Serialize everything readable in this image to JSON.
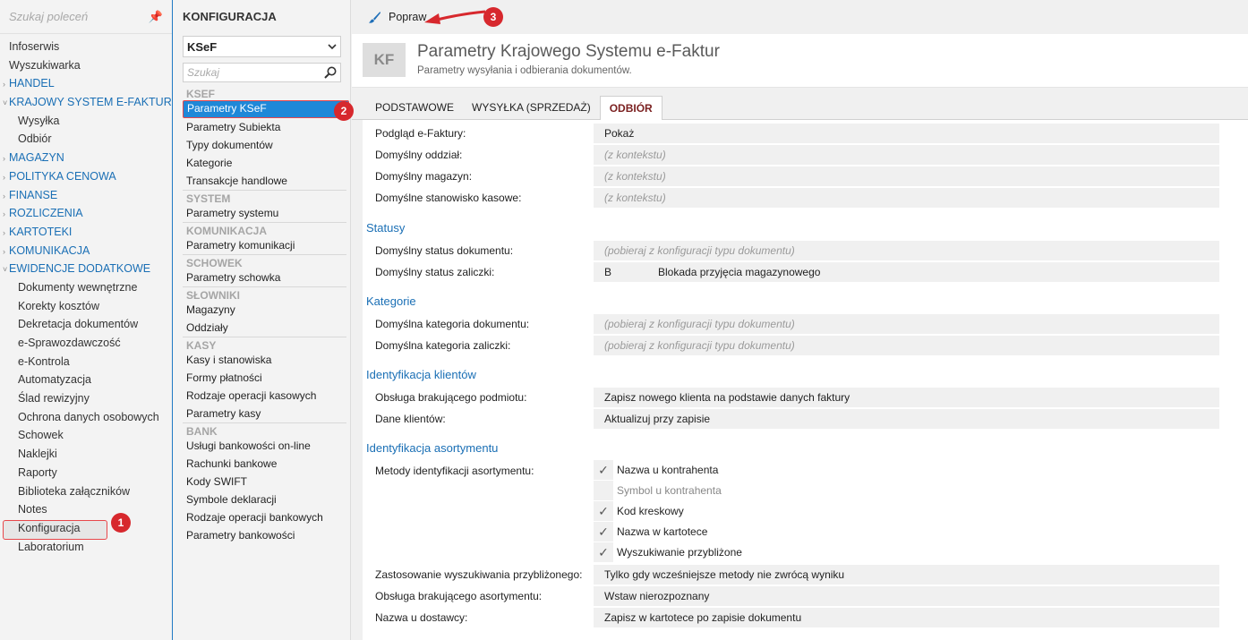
{
  "nav": {
    "search_placeholder": "Szukaj poleceń",
    "items": [
      {
        "type": "top",
        "label": "Infoserwis"
      },
      {
        "type": "top",
        "label": "Wyszukiwarka"
      },
      {
        "type": "sect",
        "label": "HANDEL",
        "chev": "›"
      },
      {
        "type": "sect",
        "label": "KRAJOWY SYSTEM E-FAKTUR",
        "chev": "˅"
      },
      {
        "type": "sub",
        "label": "Wysyłka"
      },
      {
        "type": "sub",
        "label": "Odbiór"
      },
      {
        "type": "sect",
        "label": "MAGAZYN",
        "chev": "›"
      },
      {
        "type": "sect",
        "label": "POLITYKA CENOWA",
        "chev": "›"
      },
      {
        "type": "sect",
        "label": "FINANSE",
        "chev": "›"
      },
      {
        "type": "sect",
        "label": "ROZLICZENIA",
        "chev": "›"
      },
      {
        "type": "sect",
        "label": "KARTOTEKI",
        "chev": "›"
      },
      {
        "type": "sect",
        "label": "KOMUNIKACJA",
        "chev": "›"
      },
      {
        "type": "sect",
        "label": "EWIDENCJE DODATKOWE",
        "chev": "˅"
      },
      {
        "type": "sub",
        "label": "Dokumenty wewnętrzne"
      },
      {
        "type": "sub",
        "label": "Korekty kosztów"
      },
      {
        "type": "sub",
        "label": "Dekretacja dokumentów"
      },
      {
        "type": "sub",
        "label": "e-Sprawozdawczość"
      },
      {
        "type": "sub",
        "label": "e-Kontrola"
      },
      {
        "type": "sub",
        "label": "Automatyzacja"
      },
      {
        "type": "sub",
        "label": "Ślad rewizyjny"
      },
      {
        "type": "sub",
        "label": "Ochrona danych osobowych"
      },
      {
        "type": "sub",
        "label": "Schowek"
      },
      {
        "type": "sub",
        "label": "Naklejki"
      },
      {
        "type": "sub",
        "label": "Raporty"
      },
      {
        "type": "sub",
        "label": "Biblioteka załączników"
      },
      {
        "type": "sub",
        "label": "Notes"
      },
      {
        "type": "sub",
        "label": "Konfiguracja",
        "selected": true
      },
      {
        "type": "sub",
        "label": "Laboratorium"
      }
    ]
  },
  "cfg": {
    "title": "KONFIGURACJA",
    "combo_value": "KSeF",
    "search_placeholder": "Szukaj",
    "groups": [
      {
        "name": "KSEF",
        "items": [
          "Parametry KSeF",
          "Parametry Subiekta",
          "Typy dokumentów",
          "Kategorie",
          "Transakcje handlowe"
        ]
      },
      {
        "name": "SYSTEM",
        "items": [
          "Parametry systemu"
        ]
      },
      {
        "name": "KOMUNIKACJA",
        "items": [
          "Parametry komunikacji"
        ]
      },
      {
        "name": "SCHOWEK",
        "items": [
          "Parametry schowka"
        ]
      },
      {
        "name": "SŁOWNIKI",
        "items": [
          "Magazyny",
          "Oddziały"
        ]
      },
      {
        "name": "KASY",
        "items": [
          "Kasy i stanowiska",
          "Formy płatności",
          "Rodzaje operacji kasowych",
          "Parametry kasy"
        ]
      },
      {
        "name": "BANK",
        "items": [
          "Usługi bankowości on-line",
          "Rachunki bankowe",
          "Kody SWIFT",
          "Symbole deklaracji",
          "Rodzaje operacji bankowych",
          "Parametry bankowości"
        ]
      }
    ],
    "active_item": "Parametry KSeF"
  },
  "toolbar": {
    "edit_label": "Popraw"
  },
  "header": {
    "badge": "KF",
    "title": "Parametry Krajowego Systemu e-Faktur",
    "subtitle": "Parametry wysyłania i odbierania dokumentów."
  },
  "tabs": [
    {
      "label": "PODSTAWOWE",
      "active": false
    },
    {
      "label": "WYSYŁKA (SPRZEDAŻ)",
      "active": false
    },
    {
      "label": "ODBIÓR",
      "active": true
    }
  ],
  "form": {
    "rows1": [
      {
        "label": "Podgląd e-Faktury:",
        "value": "Pokaż",
        "ph": false
      },
      {
        "label": "Domyślny oddział:",
        "value": "(z kontekstu)",
        "ph": true
      },
      {
        "label": "Domyślny magazyn:",
        "value": "(z kontekstu)",
        "ph": true
      },
      {
        "label": "Domyślne stanowisko kasowe:",
        "value": "(z kontekstu)",
        "ph": true
      }
    ],
    "sec_statusy": "Statusy",
    "status_doc": {
      "label": "Domyślny status dokumentu:",
      "value": "(pobieraj z konfiguracji typu dokumentu)"
    },
    "status_zal": {
      "label": "Domyślny status zaliczki:",
      "code": "B",
      "value": "Blokada przyjęcia magazynowego"
    },
    "sec_kategorie": "Kategorie",
    "kat_doc": {
      "label": "Domyślna kategoria dokumentu:",
      "value": "(pobieraj z konfiguracji typu dokumentu)"
    },
    "kat_zal": {
      "label": "Domyślna kategoria zaliczki:",
      "value": "(pobieraj z konfiguracji typu dokumentu)"
    },
    "sec_klienci": "Identyfikacja klientów",
    "kl_brak": {
      "label": "Obsługa brakującego podmiotu:",
      "value": "Zapisz nowego klienta na podstawie danych faktury"
    },
    "kl_dane": {
      "label": "Dane klientów:",
      "value": "Aktualizuj przy zapisie"
    },
    "sec_asort": "Identyfikacja asortymentu",
    "metody_label": "Metody identyfikacji asortymentu:",
    "checks": [
      {
        "label": "Nazwa u kontrahenta",
        "checked": true
      },
      {
        "label": "Symbol u kontrahenta",
        "checked": false
      },
      {
        "label": "Kod kreskowy",
        "checked": true
      },
      {
        "label": "Nazwa w kartotece",
        "checked": true
      },
      {
        "label": "Wyszukiwanie przybliżone",
        "checked": true
      }
    ],
    "zast": {
      "label": "Zastosowanie wyszukiwania przybliżonego:",
      "value": "Tylko gdy wcześniejsze metody nie zwrócą wyniku"
    },
    "brak_as": {
      "label": "Obsługa brakującego asortymentu:",
      "value": "Wstaw nierozpoznany"
    },
    "naz_dost": {
      "label": "Nazwa u dostawcy:",
      "value": "Zapisz w kartotece po zapisie dokumentu"
    }
  },
  "markers": [
    "1",
    "2",
    "3"
  ],
  "colors": {
    "accent": "#1f88d8",
    "section": "#1a6fb5",
    "marker": "#d7282d"
  }
}
